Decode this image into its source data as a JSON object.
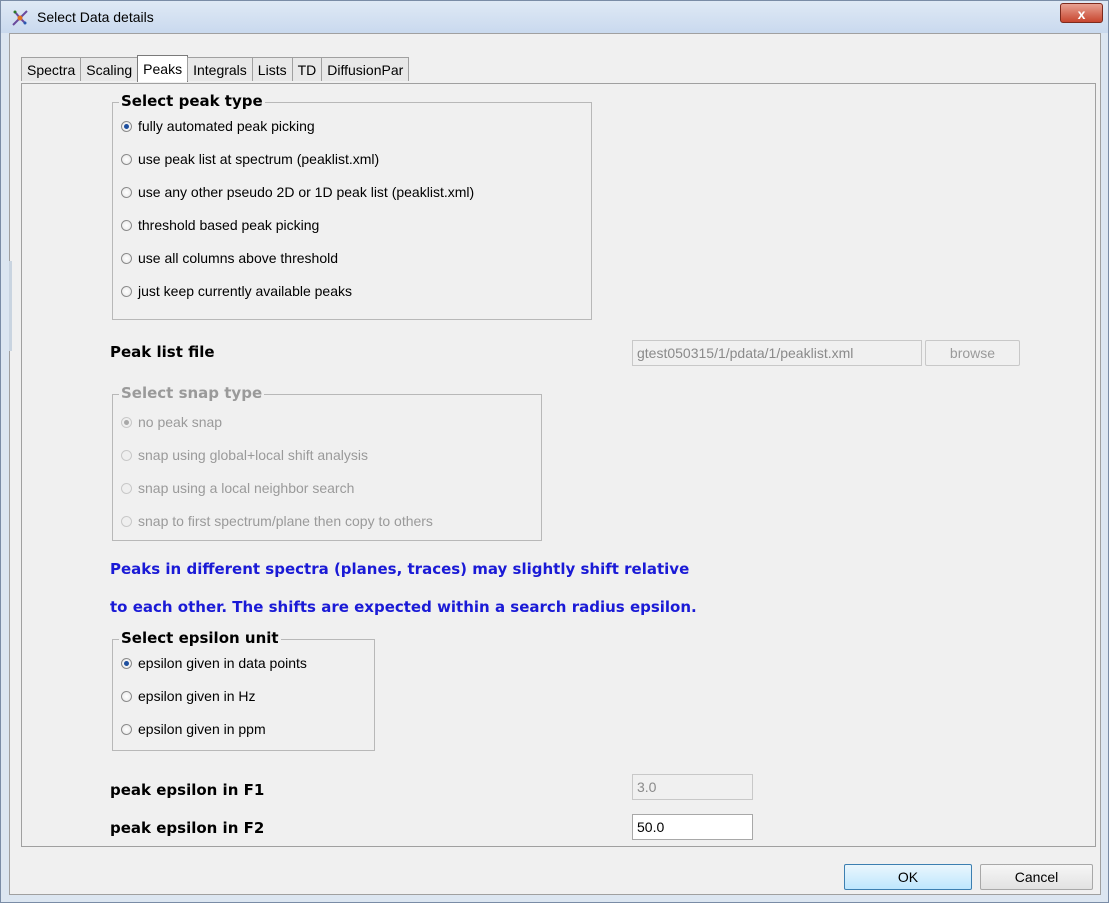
{
  "window": {
    "title": "Select Data details",
    "close_label": "x"
  },
  "tabs": [
    {
      "label": "Spectra"
    },
    {
      "label": "Scaling"
    },
    {
      "label": "Peaks"
    },
    {
      "label": "Integrals"
    },
    {
      "label": "Lists"
    },
    {
      "label": "TD"
    },
    {
      "label": "DiffusionPar"
    }
  ],
  "peak_type": {
    "title": "Select peak type",
    "options": [
      {
        "label": "fully automated peak picking",
        "checked": true
      },
      {
        "label": "use peak list at spectrum (peaklist.xml)",
        "checked": false
      },
      {
        "label": "use any other pseudo 2D or 1D peak list (peaklist.xml)",
        "checked": false
      },
      {
        "label": "threshold based peak picking",
        "checked": false
      },
      {
        "label": "use all columns above threshold",
        "checked": false
      },
      {
        "label": "just keep currently available peaks",
        "checked": false
      }
    ]
  },
  "peak_list": {
    "label": "Peak list file",
    "value": "gtest050315/1/pdata/1/peaklist.xml",
    "browse_label": "browse"
  },
  "snap_type": {
    "title": "Select snap type",
    "options": [
      {
        "label": "no peak snap",
        "checked": true
      },
      {
        "label": "snap using global+local shift analysis",
        "checked": false
      },
      {
        "label": "snap using a local neighbor search",
        "checked": false
      },
      {
        "label": "snap to first spectrum/plane then copy to others",
        "checked": false
      }
    ]
  },
  "info": {
    "line1": "Peaks in different spectra (planes, traces) may slightly shift relative",
    "line2": "to each other. The shifts are expected within a search radius epsilon."
  },
  "epsilon_unit": {
    "title": "Select epsilon unit",
    "options": [
      {
        "label": "epsilon given in data points",
        "checked": true
      },
      {
        "label": "epsilon given in Hz",
        "checked": false
      },
      {
        "label": "epsilon given in ppm",
        "checked": false
      }
    ]
  },
  "epsilon_f1": {
    "label": "peak epsilon in F1",
    "value": "3.0"
  },
  "epsilon_f2": {
    "label": "peak epsilon in F2",
    "value": "50.0"
  },
  "footer": {
    "ok_label": "OK",
    "cancel_label": "Cancel"
  },
  "colors": {
    "info_text": "#1a1ad6",
    "radio_dot": "#1e4f9e",
    "close_button": "#c7462f"
  }
}
